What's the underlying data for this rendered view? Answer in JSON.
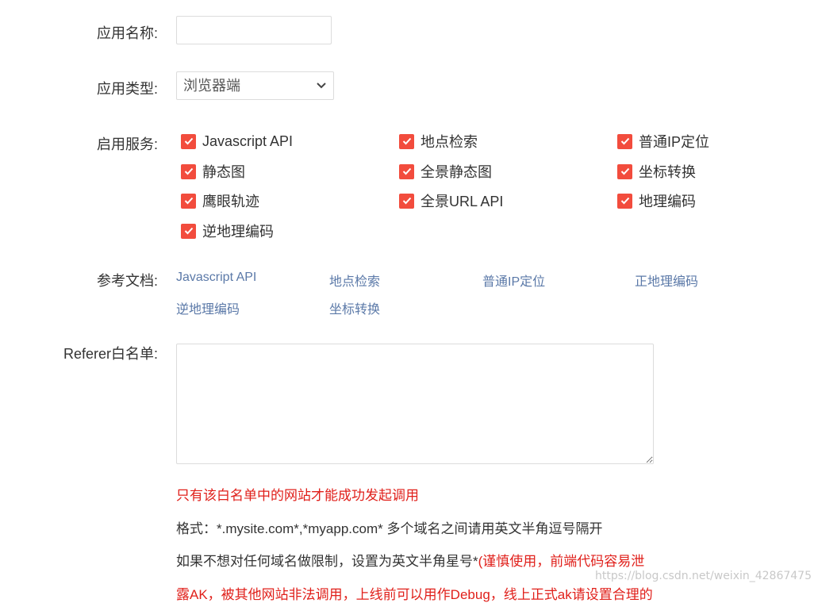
{
  "form": {
    "app_name_label": "应用名称:",
    "app_name_value": "",
    "app_type_label": "应用类型:",
    "app_type_selected": "浏览器端",
    "services_label": "启用服务:",
    "services": [
      {
        "label": "Javascript API",
        "checked": true
      },
      {
        "label": "地点检索",
        "checked": true
      },
      {
        "label": "普通IP定位",
        "checked": true
      },
      {
        "label": "静态图",
        "checked": true
      },
      {
        "label": "全景静态图",
        "checked": true
      },
      {
        "label": "坐标转换",
        "checked": true
      },
      {
        "label": "鹰眼轨迹",
        "checked": true
      },
      {
        "label": "全景URL API",
        "checked": true
      },
      {
        "label": "地理编码",
        "checked": true
      },
      {
        "label": "逆地理编码",
        "checked": true
      }
    ],
    "docs_label": "参考文档:",
    "docs": [
      "Javascript API",
      "地点检索",
      "普通IP定位",
      "正地理编码",
      "逆地理编码",
      "坐标转换"
    ],
    "referer_label": "Referer白名单:",
    "referer_value": "",
    "help": {
      "line1": "只有该白名单中的网站才能成功发起调用",
      "line2": "格式：*.mysite.com*,*myapp.com* 多个域名之间请用英文半角逗号隔开",
      "line3_dark": "如果不想对任何域名做限制，设置为英文半角星号*",
      "line3_red": "(谨慎使用，前端代码容易泄",
      "line4": "露AK，被其他网站非法调用，上线前可以用作Debug，线上正式ak请设置合理的"
    }
  },
  "watermark": "https://blog.csdn.net/weixin_42867475",
  "colors": {
    "checkbox": "#f24c3d",
    "link": "#5b79a8",
    "warning": "#e0201b"
  }
}
